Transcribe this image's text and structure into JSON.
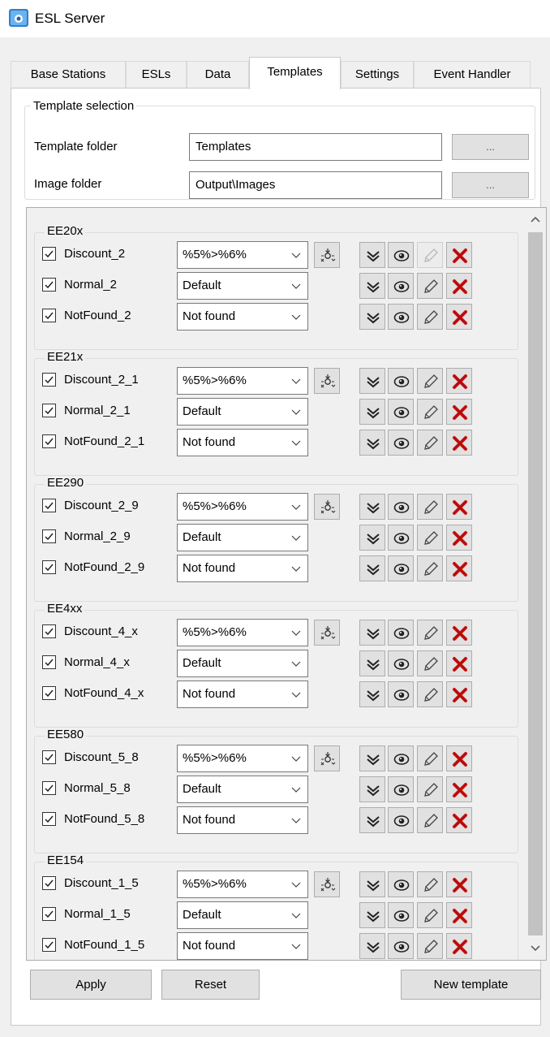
{
  "window": {
    "title": "ESL Server"
  },
  "tabs": [
    {
      "label": "Base Stations"
    },
    {
      "label": "ESLs"
    },
    {
      "label": "Data"
    },
    {
      "label": "Templates"
    },
    {
      "label": "Settings"
    },
    {
      "label": "Event Handler"
    }
  ],
  "active_tab": "Templates",
  "template_selection": {
    "group_label": "Template selection",
    "template_folder_label": "Template folder",
    "template_folder_value": "Templates",
    "image_folder_label": "Image folder",
    "image_folder_value": "Output\\Images",
    "browse_label": "..."
  },
  "groups": [
    {
      "name": "EE20x",
      "rows": [
        {
          "name": "Discount_2",
          "checked": true,
          "combo": "%5%>%6%",
          "has_mapper": true,
          "edit_enabled": false
        },
        {
          "name": "Normal_2",
          "checked": true,
          "combo": "Default",
          "has_mapper": false,
          "edit_enabled": true
        },
        {
          "name": "NotFound_2",
          "checked": true,
          "combo": "Not found",
          "has_mapper": false,
          "edit_enabled": true
        }
      ]
    },
    {
      "name": "EE21x",
      "rows": [
        {
          "name": "Discount_2_1",
          "checked": true,
          "combo": "%5%>%6%",
          "has_mapper": true,
          "edit_enabled": true
        },
        {
          "name": "Normal_2_1",
          "checked": true,
          "combo": "Default",
          "has_mapper": false,
          "edit_enabled": true
        },
        {
          "name": "NotFound_2_1",
          "checked": true,
          "combo": "Not found",
          "has_mapper": false,
          "edit_enabled": true
        }
      ]
    },
    {
      "name": "EE290",
      "rows": [
        {
          "name": "Discount_2_9",
          "checked": true,
          "combo": "%5%>%6%",
          "has_mapper": true,
          "edit_enabled": true
        },
        {
          "name": "Normal_2_9",
          "checked": true,
          "combo": "Default",
          "has_mapper": false,
          "edit_enabled": true
        },
        {
          "name": "NotFound_2_9",
          "checked": true,
          "combo": "Not found",
          "has_mapper": false,
          "edit_enabled": true
        }
      ]
    },
    {
      "name": "EE4xx",
      "rows": [
        {
          "name": "Discount_4_x",
          "checked": true,
          "combo": "%5%>%6%",
          "has_mapper": true,
          "edit_enabled": true
        },
        {
          "name": "Normal_4_x",
          "checked": true,
          "combo": "Default",
          "has_mapper": false,
          "edit_enabled": true
        },
        {
          "name": "NotFound_4_x",
          "checked": true,
          "combo": "Not found",
          "has_mapper": false,
          "edit_enabled": true
        }
      ]
    },
    {
      "name": "EE580",
      "rows": [
        {
          "name": "Discount_5_8",
          "checked": true,
          "combo": "%5%>%6%",
          "has_mapper": true,
          "edit_enabled": true
        },
        {
          "name": "Normal_5_8",
          "checked": true,
          "combo": "Default",
          "has_mapper": false,
          "edit_enabled": true
        },
        {
          "name": "NotFound_5_8",
          "checked": true,
          "combo": "Not found",
          "has_mapper": false,
          "edit_enabled": true
        }
      ]
    },
    {
      "name": "EE154",
      "rows": [
        {
          "name": "Discount_1_5",
          "checked": true,
          "combo": "%5%>%6%",
          "has_mapper": true,
          "edit_enabled": true
        },
        {
          "name": "Normal_1_5",
          "checked": true,
          "combo": "Default",
          "has_mapper": false,
          "edit_enabled": true
        },
        {
          "name": "NotFound_1_5",
          "checked": true,
          "combo": "Not found",
          "has_mapper": false,
          "edit_enabled": true
        }
      ]
    }
  ],
  "row_icons": [
    "field-mapping-icon",
    "expand-chevron-icon",
    "preview-eye-icon",
    "edit-pencil-icon",
    "delete-x-icon"
  ],
  "buttons": {
    "apply": "Apply",
    "reset": "Reset",
    "new_template": "New template"
  },
  "colors": {
    "delete_red": "#cc1111",
    "scroll_thumb": "#c2c2c2"
  }
}
